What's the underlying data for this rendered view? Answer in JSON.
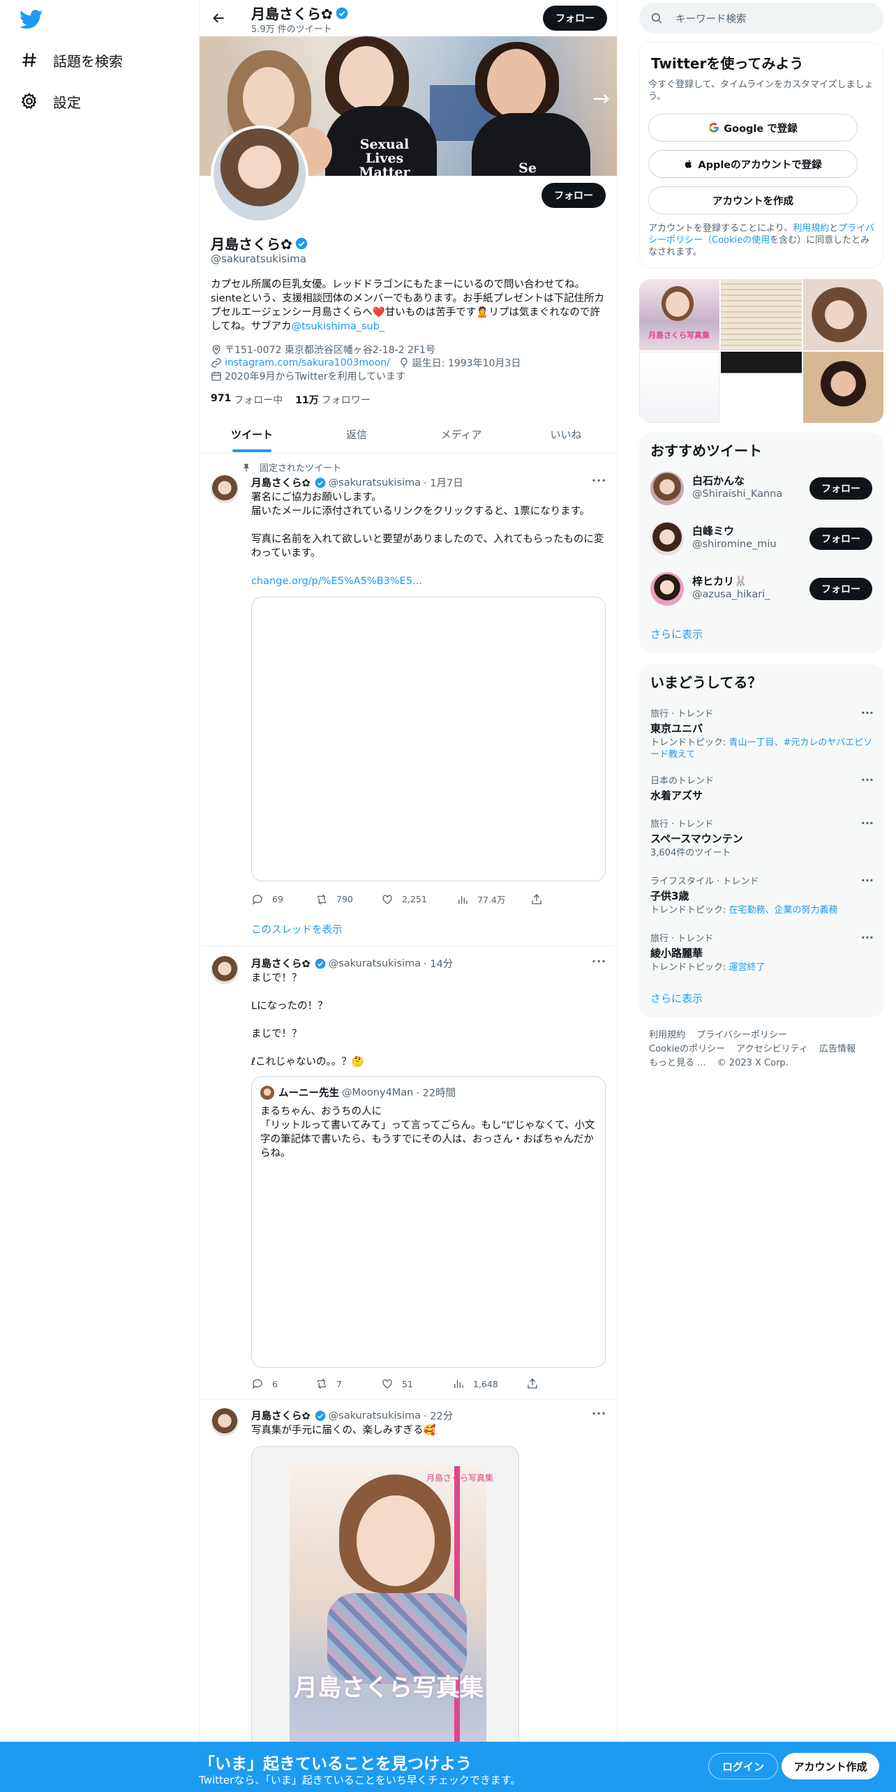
{
  "nav": {
    "explore_label": "話題を検索",
    "settings_label": "設定"
  },
  "header": {
    "name": "月島さくら✿",
    "tweet_count": "5.9万 件のツイート",
    "follow_label": "フォロー"
  },
  "banner": {
    "shirt_text_1": "Sexual\nLives\nMatter",
    "shirt_text_2": "Se"
  },
  "profile": {
    "name": "月島さくら✿",
    "handle": "@sakuratsukisima",
    "follow_label": "フォロー",
    "bio_main": "カプセル所属の巨乳女優。レッドドラゴンにもたまーにいるので問い合わせてね。sienteという、支援相談団体のメンバーでもあります。お手紙プレゼントは下記住所カプセルエージェンシー月島さくらへ❤️甘いものは苦手です🙎リプは気まぐれなので許してね。サブアカ",
    "bio_link": "@tsukishima_sub_",
    "address": "〒151-0072 東京都渋谷区幡ヶ谷2-18-2 2F1号",
    "website": "instagram.com/sakura1003moon/",
    "birthday": "誕生日: 1993年10月3日",
    "joined": "2020年9月からTwitterを利用しています",
    "following_count": "971",
    "following_label": "フォロー中",
    "followers_count": "11万",
    "followers_label": "フォロワー"
  },
  "tabs": [
    "ツイート",
    "返信",
    "メディア",
    "いいね"
  ],
  "tweets": [
    {
      "pinned_label": "固定されたツイート",
      "name": "月島さくら✿",
      "handle": "@sakuratsukisima",
      "time": "· 1月7日",
      "text": "署名にご協力お願いします。\n届いたメールに添付されているリンクをクリックすると、1票になります。\n\n写真に名前を入れて欲しいと要望がありましたので、入れてもらったものに変わっています。",
      "link": "change.org/p/%E5%A5%B3%E5...",
      "replies": "69",
      "retweets": "790",
      "likes": "2,251",
      "views": "77.4万",
      "show_thread": "このスレッドを表示"
    },
    {
      "name": "月島さくら✿",
      "handle": "@sakuratsukisima",
      "time": "· 14分",
      "text": "まじで！？\n\nLになったの！？\n\nまじで！？\n\nℓこれじゃないの。。？🤔",
      "quote": {
        "name": "ムーニー先生",
        "handle": "@Moony4Man",
        "time": "· 22時間",
        "text": "まるちゃん、おうちの人に\n「リットルって書いてみて」って言ってごらん。もし“L”じゃなくて、小文字の筆記体で書いたら、もうすでにその人は、おっさん・おばちゃんだからね。"
      },
      "replies": "6",
      "retweets": "7",
      "likes": "51",
      "views": "1,648"
    },
    {
      "name": "月島さくら✿",
      "handle": "@sakuratsukisima",
      "time": "· 22分",
      "text": "写真集が手元に届くの、楽しみすぎる🥰",
      "book_title": "月島さくら写真集",
      "book_top": "月島さくら写真集"
    }
  ],
  "search": {
    "placeholder": "キーワード検索"
  },
  "signup_panel": {
    "title": "Twitterを使ってみよう",
    "subtitle": "今すぐ登録して、タイムラインをカスタマイズしましょう。",
    "google_label": "Google で登録",
    "apple_label": "Appleのアカウントで登録",
    "create_label": "アカウントを作成",
    "legal_1": "アカウントを登録することにより、",
    "legal_terms": "利用規約",
    "legal_2": "と",
    "legal_privacy": "プライバシーポリシー（Cookieの使用",
    "legal_3": "を含む）に同意したとみなされます。"
  },
  "media_grid": {
    "caption_1": "月島さくら写真集"
  },
  "recommend": {
    "title": "おすすめツイート",
    "users": [
      {
        "name": "白石かんな",
        "handle": "@Shiraishi_Kanna",
        "button": "フォロー"
      },
      {
        "name": "白峰ミウ",
        "handle": "@shiromine_miu",
        "button": "フォロー"
      },
      {
        "name": "梓ヒカリ🐰",
        "handle": "@azusa_hikari_",
        "button": "フォロー"
      }
    ],
    "show_more": "さらに表示"
  },
  "trends": {
    "title": "いまどうしてる？",
    "items": [
      {
        "context": "旅行 · トレンド",
        "title": "東京ユニバ",
        "sub_label": "トレンドトピック: ",
        "sub_topics": "青山一丁目、#元カレのヤバエピソード教えて"
      },
      {
        "context": "日本のトレンド",
        "title": "水着アズサ",
        "sub_label": "",
        "sub_topics": ""
      },
      {
        "context": "旅行 · トレンド",
        "title": "スペースマウンテン",
        "sub_label": "3,604件のツイート",
        "sub_topics": ""
      },
      {
        "context": "ライフスタイル · トレンド",
        "title": "子供3歳",
        "sub_label": "トレンドトピック: ",
        "sub_topics": "在宅勤務、企業の努力義務"
      },
      {
        "context": "旅行 · トレンド",
        "title": "綾小路麗華",
        "sub_label": "トレンドトピック: ",
        "sub_topics": "運営終了"
      }
    ],
    "show_more": "さらに表示"
  },
  "footer": {
    "terms": "利用規約",
    "privacy": "プライバシーポリシー",
    "cookie": "Cookieのポリシー",
    "accessibility": "アクセシビリティ",
    "ads": "広告情報",
    "more": "もっと見る ...",
    "copyright": "© 2023 X Corp."
  },
  "bottom_bar": {
    "title": "「いま」起きていることを見つけよう",
    "subtitle": "Twitterなら、「いま」起きていることをいち早くチェックできます。",
    "login_label": "ログイン",
    "signup_label": "アカウント作成"
  },
  "colors": {
    "accent": "#1d9bf0",
    "text": "#0f1419",
    "secondary": "#536471"
  }
}
